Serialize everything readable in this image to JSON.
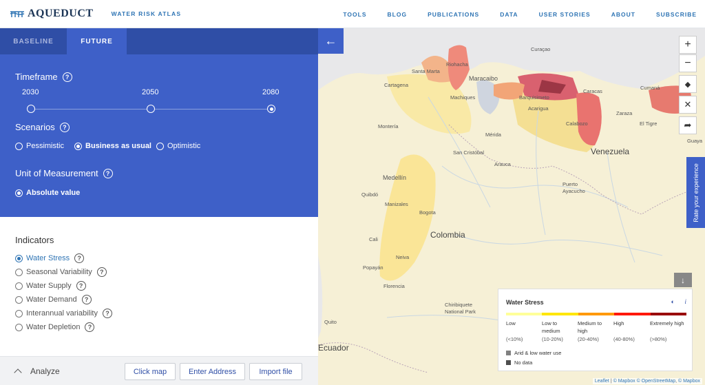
{
  "header": {
    "logo": "AQUEDUCT",
    "subtitle": "WATER RISK ATLAS",
    "nav": [
      "TOOLS",
      "BLOG",
      "PUBLICATIONS",
      "DATA",
      "USER STORIES",
      "ABOUT",
      "SUBSCRIBE"
    ]
  },
  "tabs": [
    {
      "label": "BASELINE",
      "active": false
    },
    {
      "label": "FUTURE",
      "active": true
    }
  ],
  "timeframe": {
    "title": "Timeframe",
    "options": [
      "2030",
      "2050",
      "2080"
    ],
    "selected": "2080"
  },
  "scenarios": {
    "title": "Scenarios",
    "options": [
      "Pessimistic",
      "Business as usual",
      "Optimistic"
    ],
    "selected": "Business as usual"
  },
  "unit": {
    "title": "Unit of Measurement",
    "options": [
      "Absolute value"
    ],
    "selected": "Absolute value"
  },
  "indicators": {
    "title": "Indicators",
    "items": [
      "Water Stress",
      "Seasonal Variability",
      "Water Supply",
      "Water Demand",
      "Interannual variability",
      "Water Depletion"
    ],
    "selected": "Water Stress"
  },
  "analyze": {
    "label": "Analyze",
    "buttons": [
      "Click map",
      "Enter Address",
      "Import file"
    ]
  },
  "map": {
    "rate_label": "Rate your experience",
    "labels": {
      "curacao": "Curaçao",
      "santa_marta": "Santa Marta",
      "riohacha": "Riohacha",
      "maracaibo": "Maracaibo",
      "cartagena": "Cartagena",
      "machiques": "Machiques",
      "barquisimeto": "Barquisimeto",
      "caracas": "Caracas",
      "cumana": "Cumaná",
      "acarigua": "Acarigua",
      "calabozo": "Calabozo",
      "zaraza": "Zaraza",
      "el_tigre": "El Tigre",
      "monteria": "Montería",
      "merida": "Mérida",
      "venezuela": "Venezuela",
      "san_cristobal": "San Cristóbal",
      "arauca": "Arauca",
      "medellin": "Medellín",
      "quibdo": "Quibdó",
      "puerto_ayacucho": "Puerto\nAyacucho",
      "manizales": "Manizales",
      "bogota": "Bogota",
      "colombia": "Colombia",
      "cali": "Cali",
      "neiva": "Neiva",
      "popayan": "Popayán",
      "florencia": "Florencia",
      "chiribiquete": "Chiribiquete\nNational Park",
      "quito": "Quito",
      "ecuador": "Ecuador",
      "guayana": "Guaya"
    },
    "attribution": {
      "leaflet": "Leaflet",
      "mapbox1": "© Mapbox",
      "osm": "© OpenStreetMap",
      "mapbox2": "© Mapbox"
    }
  },
  "legend": {
    "title": "Water Stress",
    "categories": [
      {
        "label": "Low",
        "range": "(<10%)",
        "color": "#ffff99"
      },
      {
        "label": "Low to medium",
        "range": "(10-20%)",
        "color": "#ffe600"
      },
      {
        "label": "Medium to high",
        "range": "(20-40%)",
        "color": "#ff9900"
      },
      {
        "label": "High",
        "range": "(40-80%)",
        "color": "#ff1900"
      },
      {
        "label": "Extremely high",
        "range": "(>80%)",
        "color": "#990000"
      }
    ],
    "extras": [
      {
        "label": "Arid & low water use",
        "color": "#808080"
      },
      {
        "label": "No data",
        "color": "#4e4e4e"
      }
    ]
  }
}
